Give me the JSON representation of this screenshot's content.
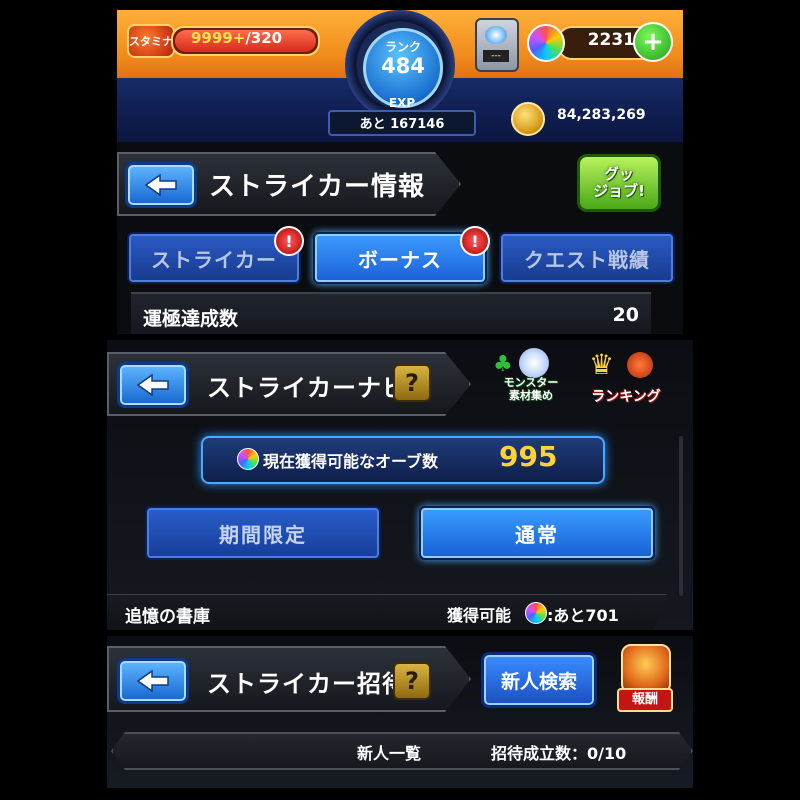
{
  "status": {
    "stamina_icon": "スタミナ",
    "stamina_current": "9999+",
    "stamina_max": "/320",
    "rank_label": "ランク",
    "rank_value": "484",
    "exp_label": "EXP",
    "exp_remaining": "あと 167146",
    "box_slot": "---",
    "orb_count": "2231",
    "gold": "84,283,269",
    "accent_orange": "#f08a1b",
    "accent_blue": "#1a6fd0"
  },
  "striker_info": {
    "title": "ストライカー情報",
    "good_job": "グッ\nジョブ!",
    "tabs": [
      {
        "label": "ストライカー",
        "alert": "!"
      },
      {
        "label": "ボーナス",
        "alert": "!"
      },
      {
        "label": "クエスト戦績"
      }
    ],
    "row_label": "運極達成数",
    "row_value": "20"
  },
  "striker_navi": {
    "title": "ストライカーナビ",
    "help": "?",
    "monster_label": "モンスター\n素材集め",
    "ranking_label": "ランキング",
    "banner_text": "現在獲得可能なオーブ数",
    "banner_value": "995",
    "buttons": [
      "期間限定",
      "通常"
    ],
    "footer_left": "追憶の書庫",
    "footer_right_prefix": "獲得可能",
    "footer_right_value": ":あと701"
  },
  "striker_invite": {
    "title": "ストライカー招待",
    "help": "?",
    "search_button": "新人検索",
    "reward_label": "報酬",
    "list_label": "新人一覧",
    "invite_count": "招待成立数：0/10"
  }
}
